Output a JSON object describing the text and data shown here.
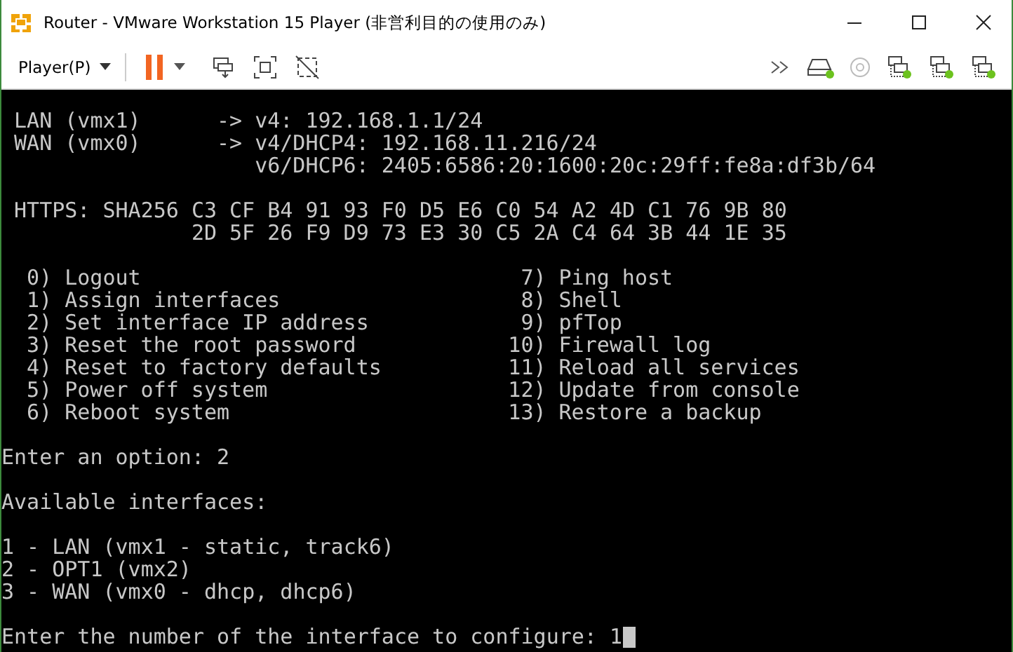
{
  "window": {
    "title": "Router - VMware Workstation 15 Player (非営利目的の使用のみ)"
  },
  "toolbar": {
    "menu": "Player(P)"
  },
  "console": {
    "interfaces": [
      {
        "name": "LAN (vmx1)",
        "arrow": "->",
        "addresses": [
          "v4: 192.168.1.1/24"
        ]
      },
      {
        "name": "WAN (vmx0)",
        "arrow": "->",
        "addresses": [
          "v4/DHCP4: 192.168.11.216/24",
          "v6/DHCP6: 2405:6586:20:1600:20c:29ff:fe8a:df3b/64"
        ]
      }
    ],
    "https": {
      "label": "HTTPS: SHA256",
      "lines": [
        "C3 CF B4 91 93 F0 D5 E6 C0 54 A2 4D C1 76 9B 80",
        "2D 5F 26 F9 D9 73 E3 30 C5 2A C4 64 3B 44 1E 35"
      ]
    },
    "menu": [
      {
        "number": "0)",
        "label": "Logout"
      },
      {
        "number": "1)",
        "label": "Assign interfaces"
      },
      {
        "number": "2)",
        "label": "Set interface IP address"
      },
      {
        "number": "3)",
        "label": "Reset the root password"
      },
      {
        "number": "4)",
        "label": "Reset to factory defaults"
      },
      {
        "number": "5)",
        "label": "Power off system"
      },
      {
        "number": "6)",
        "label": "Reboot system"
      },
      {
        "number": "7)",
        "label": "Ping host"
      },
      {
        "number": "8)",
        "label": "Shell"
      },
      {
        "number": "9)",
        "label": "pfTop"
      },
      {
        "number": "10)",
        "label": "Firewall log"
      },
      {
        "number": "11)",
        "label": "Reload all services"
      },
      {
        "number": "12)",
        "label": "Update from console"
      },
      {
        "number": "13)",
        "label": "Restore a backup"
      }
    ],
    "option_prompt": "Enter an option: 2",
    "available_heading": "Available interfaces:",
    "available": [
      "1 - LAN (vmx1 - static, track6)",
      "2 - OPT1 (vmx2)",
      "3 - WAN (vmx0 - dhcp, dhcp6)"
    ],
    "final_prompt": "Enter the number of the interface to configure: 1"
  }
}
